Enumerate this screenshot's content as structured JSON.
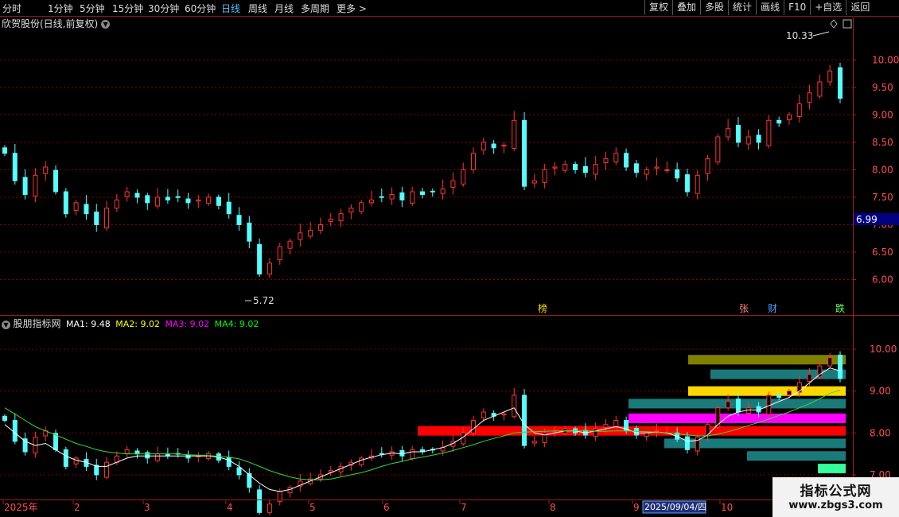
{
  "toolbar": {
    "periods": [
      "分时",
      "1分钟",
      "5分钟",
      "15分钟",
      "30分钟",
      "60分钟",
      "日线",
      "周线",
      "月线",
      "多周期",
      "更多"
    ],
    "active_period": "日线",
    "buttons": [
      "复权",
      "叠加",
      "多股",
      "统计",
      "画线",
      "F10",
      "+自选",
      "返回"
    ]
  },
  "main": {
    "title": "欣贺股份(日线,前复权)",
    "high_label": "10.33",
    "low_label": "5.72",
    "last_price_tag": "6.99"
  },
  "indicator": {
    "name": "股朋指标网",
    "ma1_label": "MA1: 9.48",
    "ma2_label": "MA2: 9.02",
    "ma3_label": "MA3: 9.02",
    "ma4_label": "MA4: 9.02"
  },
  "markers": {
    "bang": "榜",
    "zhang": "张",
    "cai": "财",
    "die": "跌"
  },
  "x_axis": {
    "year_label": "2025年",
    "month_labels": [
      "2",
      "3",
      "4",
      "5",
      "6",
      "7",
      "8",
      "9",
      "10"
    ],
    "cursor_date": "2025/09/04/四"
  },
  "watermark": {
    "line1": "指标公式网",
    "line2": "www.zbgs3.com"
  },
  "colors": {
    "up": "#ff3333",
    "down": "#54ffff",
    "ma1": "#ffffff",
    "ma2": "#ffff00",
    "ma3": "#ff00ff",
    "ma4": "#00ff00",
    "grid": "#8b0000"
  },
  "chart_data": [
    {
      "type": "candlestick",
      "title": "欣贺股份(日线,前复权)",
      "ylim": [
        5.5,
        10.6
      ],
      "y_ticks": [
        6.0,
        6.5,
        7.0,
        7.5,
        8.0,
        8.5,
        9.0,
        9.5,
        10.0
      ],
      "x_month_ticks": [
        "2025年",
        "2",
        "3",
        "4",
        "5",
        "6",
        "7",
        "8",
        "9",
        "10"
      ],
      "series": [
        {
          "values": [
            8.3,
            7.8,
            7.55,
            7.9,
            8.05,
            7.6,
            7.2,
            7.4,
            7.2,
            7.0,
            7.3,
            7.45,
            7.6,
            7.5,
            7.4,
            7.5,
            7.45,
            7.5,
            7.4,
            7.45,
            7.5,
            7.35,
            7.2,
            7.0,
            6.7,
            6.1,
            6.3,
            6.6,
            6.7,
            6.85,
            6.9,
            7.0,
            7.1,
            7.2,
            7.3,
            7.4,
            7.45,
            7.5,
            7.55,
            7.45,
            7.6,
            7.55,
            7.6,
            7.65,
            7.8,
            8.0,
            8.3,
            8.5,
            8.4,
            8.45,
            8.9,
            7.7,
            7.8,
            8.0,
            8.05,
            8.1,
            8.0,
            7.95,
            8.1,
            8.2,
            8.3,
            8.05,
            7.95,
            8.0,
            8.05,
            8.0,
            7.85,
            7.6,
            7.9,
            8.2,
            8.6,
            8.75,
            8.5,
            8.6,
            8.5,
            8.9,
            8.85,
            9.0,
            9.2,
            9.4,
            9.6,
            9.8,
            9.3
          ]
        },
        {
          "name": "MA1",
          "values": [
            8.2,
            8.0,
            7.8,
            7.7,
            7.75,
            7.6,
            7.45,
            7.35,
            7.3,
            7.2,
            7.2,
            7.3,
            7.4,
            7.45,
            7.45,
            7.45,
            7.45,
            7.45,
            7.45,
            7.45,
            7.45,
            7.42,
            7.35,
            7.2,
            7.0,
            6.8,
            6.65,
            6.6,
            6.65,
            6.75,
            6.85,
            6.95,
            7.05,
            7.15,
            7.25,
            7.35,
            7.42,
            7.48,
            7.52,
            7.5,
            7.55,
            7.55,
            7.6,
            7.65,
            7.75,
            7.9,
            8.1,
            8.3,
            8.4,
            8.5,
            8.6,
            8.2,
            8.0,
            7.95,
            8.0,
            8.05,
            8.05,
            8.0,
            8.05,
            8.1,
            8.15,
            8.1,
            8.0,
            8.0,
            8.02,
            8.0,
            7.92,
            7.8,
            7.82,
            7.95,
            8.2,
            8.4,
            8.5,
            8.55,
            8.55,
            8.65,
            8.75,
            8.85,
            9.0,
            9.2,
            9.4,
            9.55,
            9.48
          ]
        },
        {
          "name": "MA2",
          "values": [
            8.6,
            8.45,
            8.3,
            8.15,
            8.05,
            7.95,
            7.85,
            7.75,
            7.68,
            7.6,
            7.55,
            7.52,
            7.5,
            7.5,
            7.5,
            7.5,
            7.5,
            7.5,
            7.48,
            7.47,
            7.46,
            7.44,
            7.42,
            7.38,
            7.3,
            7.2,
            7.1,
            7.02,
            6.95,
            6.9,
            6.88,
            6.88,
            6.9,
            6.95,
            7.0,
            7.05,
            7.12,
            7.2,
            7.27,
            7.32,
            7.38,
            7.42,
            7.47,
            7.52,
            7.58,
            7.65,
            7.72,
            7.8,
            7.87,
            7.93,
            8.0,
            8.02,
            8.03,
            8.04,
            8.05,
            8.05,
            8.05,
            8.05,
            8.04,
            8.04,
            8.05,
            8.05,
            8.04,
            8.03,
            8.02,
            8.0,
            7.98,
            7.95,
            7.93,
            7.93,
            7.97,
            8.03,
            8.1,
            8.18,
            8.25,
            8.33,
            8.42,
            8.5,
            8.6,
            8.7,
            8.82,
            8.95,
            9.02
          ]
        }
      ]
    }
  ]
}
